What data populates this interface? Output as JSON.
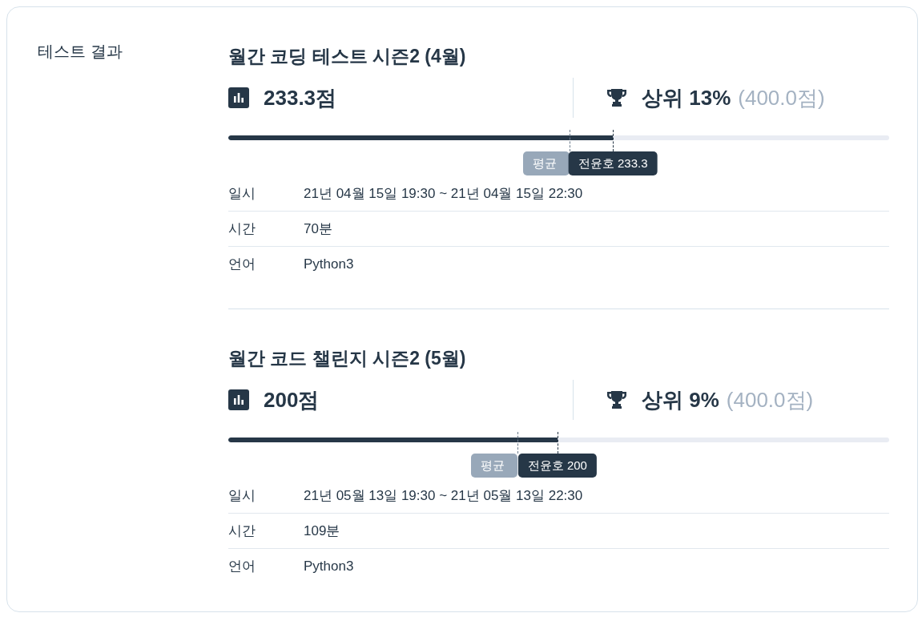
{
  "section_title": "테스트 결과",
  "tests": [
    {
      "title": "월간 코딩 테스트 시즌2 (4월)",
      "score": "233.3점",
      "rank": "상위 13%",
      "max_score": "(400.0점)",
      "progress": {
        "level": 0.582,
        "average": {
          "label": "평균",
          "level": 0.516
        },
        "marker_label": "전윤호 233.3"
      },
      "details": [
        {
          "label": "일시",
          "value": "21년 04월 15일 19:30 ~ 21년 04월 15일 22:30"
        },
        {
          "label": "시간",
          "value": "70분"
        },
        {
          "label": "언어",
          "value": "Python3"
        }
      ]
    },
    {
      "title": "월간 코드 챌린지 시즌2 (5월)",
      "score": "200점",
      "rank": "상위 9%",
      "max_score": "(400.0점)",
      "progress": {
        "level": 0.498,
        "average": {
          "label": "평균",
          "level": 0.438
        },
        "marker_label": "전윤호 200"
      },
      "details": [
        {
          "label": "일시",
          "value": "21년 05월 13일 19:30 ~ 21년 05월 13일 22:30"
        },
        {
          "label": "시간",
          "value": "109분"
        },
        {
          "label": "언어",
          "value": "Python3"
        }
      ]
    }
  ]
}
